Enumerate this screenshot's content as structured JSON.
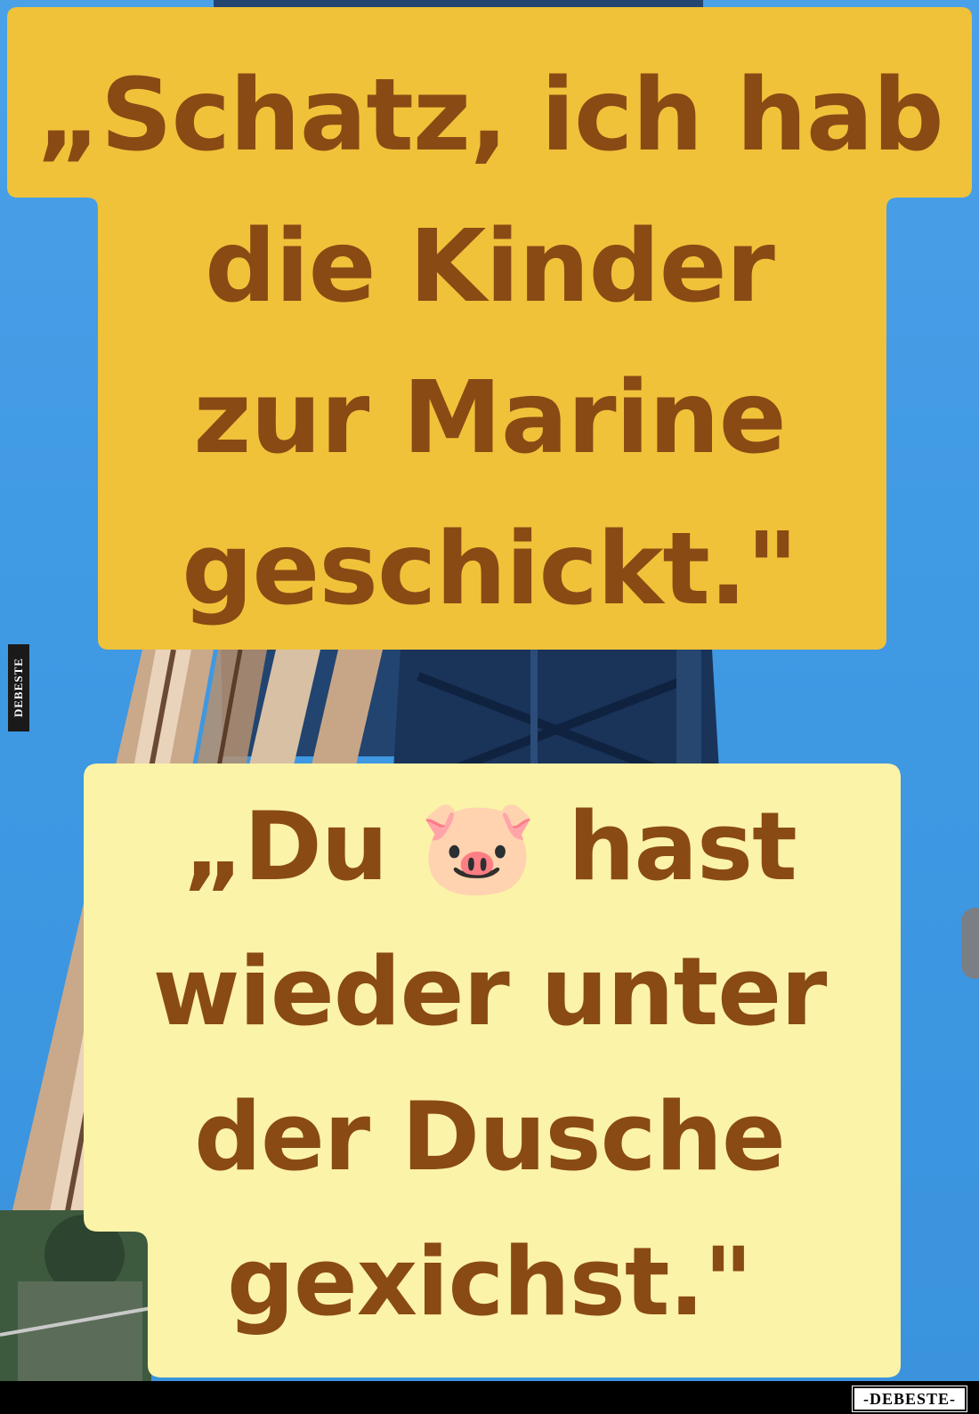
{
  "meme": {
    "top_caption": "„Schatz, ich hab\ndie Kinder\nzur Marine\ngeschickt.\"",
    "bottom_caption": "„Du 🐷 hast\nwieder unter\nder Dusche\ngexichst.\"",
    "emoji_icon": "pig-face-icon"
  },
  "watermarks": {
    "side_label": "DEBESTE",
    "footer_logo": "-DEBESTE-"
  },
  "colors": {
    "sky": "#3f9ae4",
    "top_bubble": "#f0c23a",
    "bottom_bubble": "#fbf3a8",
    "caption_text": "#8a4a14",
    "footer": "#000000"
  }
}
